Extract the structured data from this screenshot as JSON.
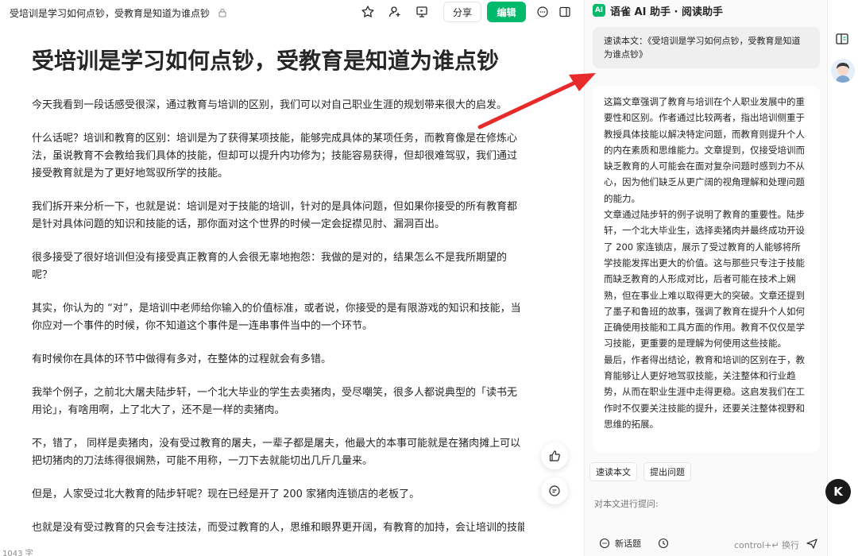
{
  "topbar": {
    "doc_title": "受培训是学习如何点钞，受教育是知道为谁点钞",
    "share_label": "分享",
    "edit_label": "编辑"
  },
  "document": {
    "title": "受培训是学习如何点钞，受教育是知道为谁点钞",
    "paragraphs": [
      "今天我看到一段话感受很深，通过教育与培训的区别，我们可以对自己职业生涯的规划带来很大的启发。",
      "什么话呢？培训和教育的区别：培训是为了获得某项技能，能够完成具体的某项任务，而教育像是在修炼心法，虽说教育不会教给我们具体的技能，但却可以提升内功修为；技能容易获得，但却很难驾驭，我们通过接受教育就是为了更好地驾驭所学的技能。",
      "我们拆开来分析一下，也就是说：培训是对于技能的培训，针对的是具体问题，但如果你接受的所有教育都是针对具体问题的知识和技能的话，那你面对这个世界的时候一定会捉襟见肘、漏洞百出。",
      "很多接受了很好培训但没有接受真正教育的人会很无辜地抱怨：我做的是对的，结果怎么不是我所期望的呢？",
      "其实，你认为的 “对”，是培训中老师给你输入的价值标准，或者说，你接受的是有限游戏的知识和技能，当你应对一个事件的时候，你不知道这个事件是一连串事件当中的一个环节。",
      "有时候你在具体的环节中做得有多对，在整体的过程就会有多错。",
      "我举个例子，之前北大屠夫陆步轩，一个北大毕业的学生去卖猪肉，受尽嘲笑，很多人都说典型的「读书无用论」，有啥用啊，上了北大了，还不是一样的卖猪肉。",
      "不，错了， 同样是卖猪肉，没有受过教育的屠夫，一辈子都是屠夫，他最大的本事可能就是在猪肉摊上可以把切猪肉的刀法练得很娴熟，可能不用称，一刀下去就能切出几斤几量来。",
      "但是，人家受过北大教育的陆步轩呢？现在已经是开了 200 家猪肉连锁店的老板了。",
      "也就是没有受过教育的只会专注技法，而受过教育的人，思维和眼界更开阔，有教育的加持，会让培训的技能无"
    ],
    "word_count": "1043 字"
  },
  "panel": {
    "logo": "AI",
    "title": "语雀 AI 助手 · 阅读助手",
    "user_message": "速读本文：《受培训是学习如何点钞，受教育是知道为谁点钞》",
    "reply_paragraphs": [
      "这篇文章强调了教育与培训在个人职业发展中的重要性和区别。作者通过比较两者，指出培训侧重于教授具体技能以解决特定问题，而教育则提升个人的内在素质和思维能力。文章提到，仅接受培训而缺乏教育的人可能会在面对复杂问题时感到力不从心，因为他们缺乏从更广阔的视角理解和处理问题的能力。",
      "文章通过陆步轩的例子说明了教育的重要性。陆步轩，一个北大毕业生，选择卖猪肉并最终成功开设了 200 家连锁店，展示了受过教育的人能够将所学技能发挥出更大的价值。这与那些只专注于技能而缺乏教育的人形成对比，后者可能在技术上娴熟，但在事业上难以取得更大的突破。文章还提到了墨子和鲁班的故事，强调了教育在提升个人如何正确使用技能和工具方面的作用。教育不仅仅是学习技能，更重要的是理解为何使用这些技能。",
      "最后，作者得出结论，教育和培训的区别在于，教育能够让人更好地驾驭技能，关注整体和行业趋势，从而在职业生涯中走得更稳。这启发我们在工作时不仅要关注技能的提升，还要关注整体视野和思维的拓展。"
    ],
    "chips": [
      "速读本文",
      "提出问题"
    ],
    "input_placeholder": "对本文进行提问:",
    "new_topic_label": "新话题",
    "send_hint": "control+↵ 换行"
  },
  "strip": {
    "k_label": "K"
  },
  "colors": {
    "accent": "#00b96b",
    "arrow": "#e82a2a"
  },
  "icons": [
    "lock-icon",
    "star-icon",
    "add-user-icon",
    "present-icon",
    "comment-icon",
    "sidebar-toggle-icon",
    "close-icon",
    "like-icon",
    "chat-icon",
    "history-icon",
    "send-icon",
    "panel-icon"
  ]
}
